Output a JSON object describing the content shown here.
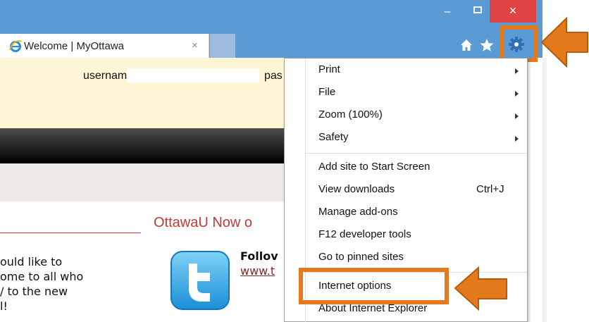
{
  "browser": {
    "tab_title": "Welcome | MyOttawa",
    "tab_close": "×",
    "minimize": "‒",
    "close": "×",
    "colors": {
      "titlebar": "#5b9bd5",
      "close": "#e04343",
      "gear": "#2f6fb5",
      "highlight": "#e47a1c"
    },
    "icons": [
      "ie-logo-icon",
      "home-icon",
      "star-icon",
      "gear-icon"
    ]
  },
  "page": {
    "username_label": "username",
    "password_label_partial": "pas",
    "headline": "OttawaU Now o",
    "body_lines": [
      "ould like to",
      "ome to all who",
      "/ to the new",
      "l!"
    ],
    "follow_text": "Follov",
    "follow_link": "www.t"
  },
  "menu": {
    "items": [
      {
        "label": "Print",
        "submenu": true
      },
      {
        "label": "File",
        "submenu": true
      },
      {
        "label": "Zoom (100%)",
        "submenu": true
      },
      {
        "label": "Safety",
        "submenu": true
      },
      {
        "label": "Add site to Start Screen",
        "submenu": false
      },
      {
        "label": "View downloads",
        "submenu": false,
        "shortcut": "Ctrl+J"
      },
      {
        "label": "Manage add-ons",
        "submenu": false
      },
      {
        "label": "F12 developer tools",
        "submenu": false
      },
      {
        "label": "Go to pinned sites",
        "submenu": false
      },
      {
        "label": "Internet options",
        "submenu": false
      },
      {
        "label": "About Internet Explorer",
        "submenu": false
      }
    ]
  }
}
